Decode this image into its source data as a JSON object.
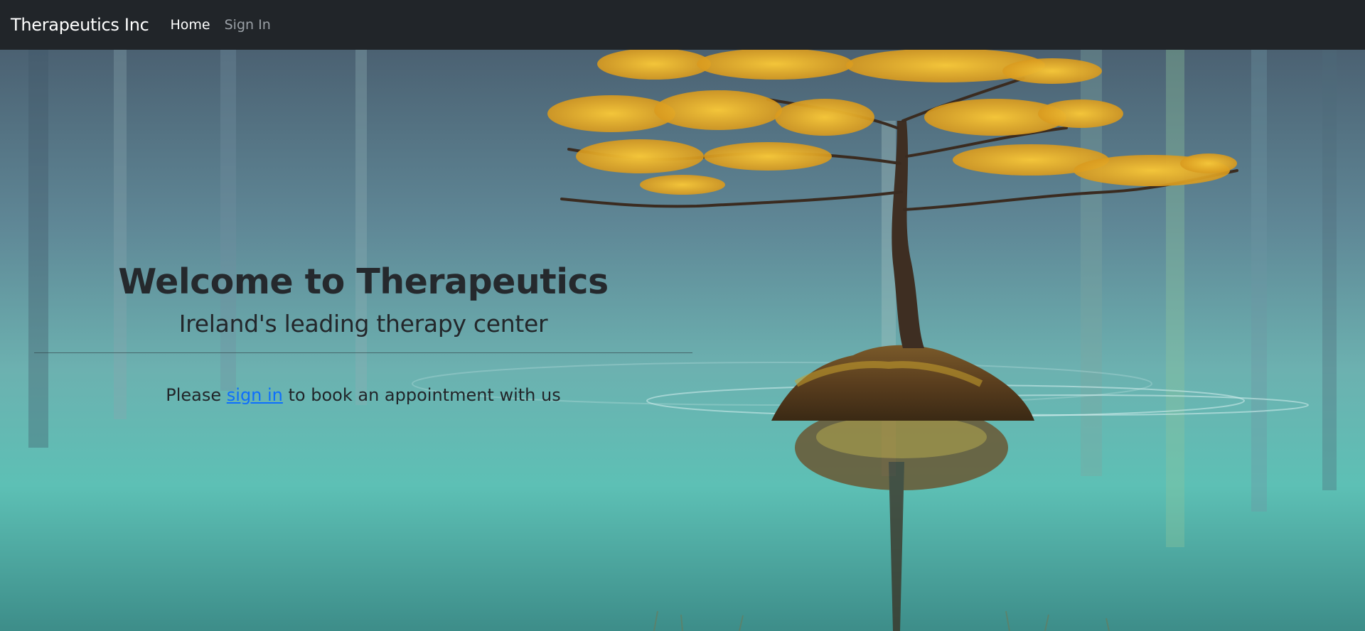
{
  "navbar": {
    "brand": "Therapeutics Inc",
    "links": [
      {
        "label": "Home",
        "active": true
      },
      {
        "label": "Sign In",
        "active": false
      }
    ],
    "background": "#212529"
  },
  "hero": {
    "title": "Welcome to Therapeutics",
    "subtitle": "Ireland's leading therapy center",
    "notice_prefix": "Please ",
    "notice_link": "sign in",
    "notice_suffix": " to book an appointment with us",
    "link_color": "#0d6efd",
    "background_image": "tree-on-island-in-lake"
  }
}
